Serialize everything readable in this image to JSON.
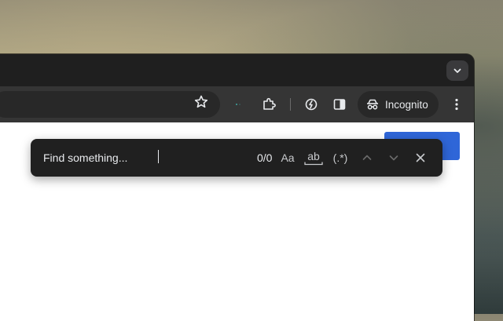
{
  "browser": {
    "incognito_label": "Incognito"
  },
  "find_bar": {
    "placeholder": "Find something...",
    "value": "",
    "match_count": "0/0",
    "match_case_label": "Aa",
    "whole_word_label": "ab",
    "regex_label": "(.*)"
  },
  "icons": {
    "tab_search": "chevron-down-icon",
    "bookmark": "star-icon",
    "extension": "puzzle-icon",
    "performance": "leaf-icon",
    "side_panel": "side-panel-icon",
    "incognito": "incognito-icon",
    "menu": "kebab-menu-icon",
    "prev": "chevron-up-icon",
    "next": "chevron-down-icon",
    "close": "close-icon"
  },
  "colors": {
    "find_bar_bg": "#202020",
    "toolbar_bg": "#353535",
    "page_accent_button": "#2f66d8"
  }
}
